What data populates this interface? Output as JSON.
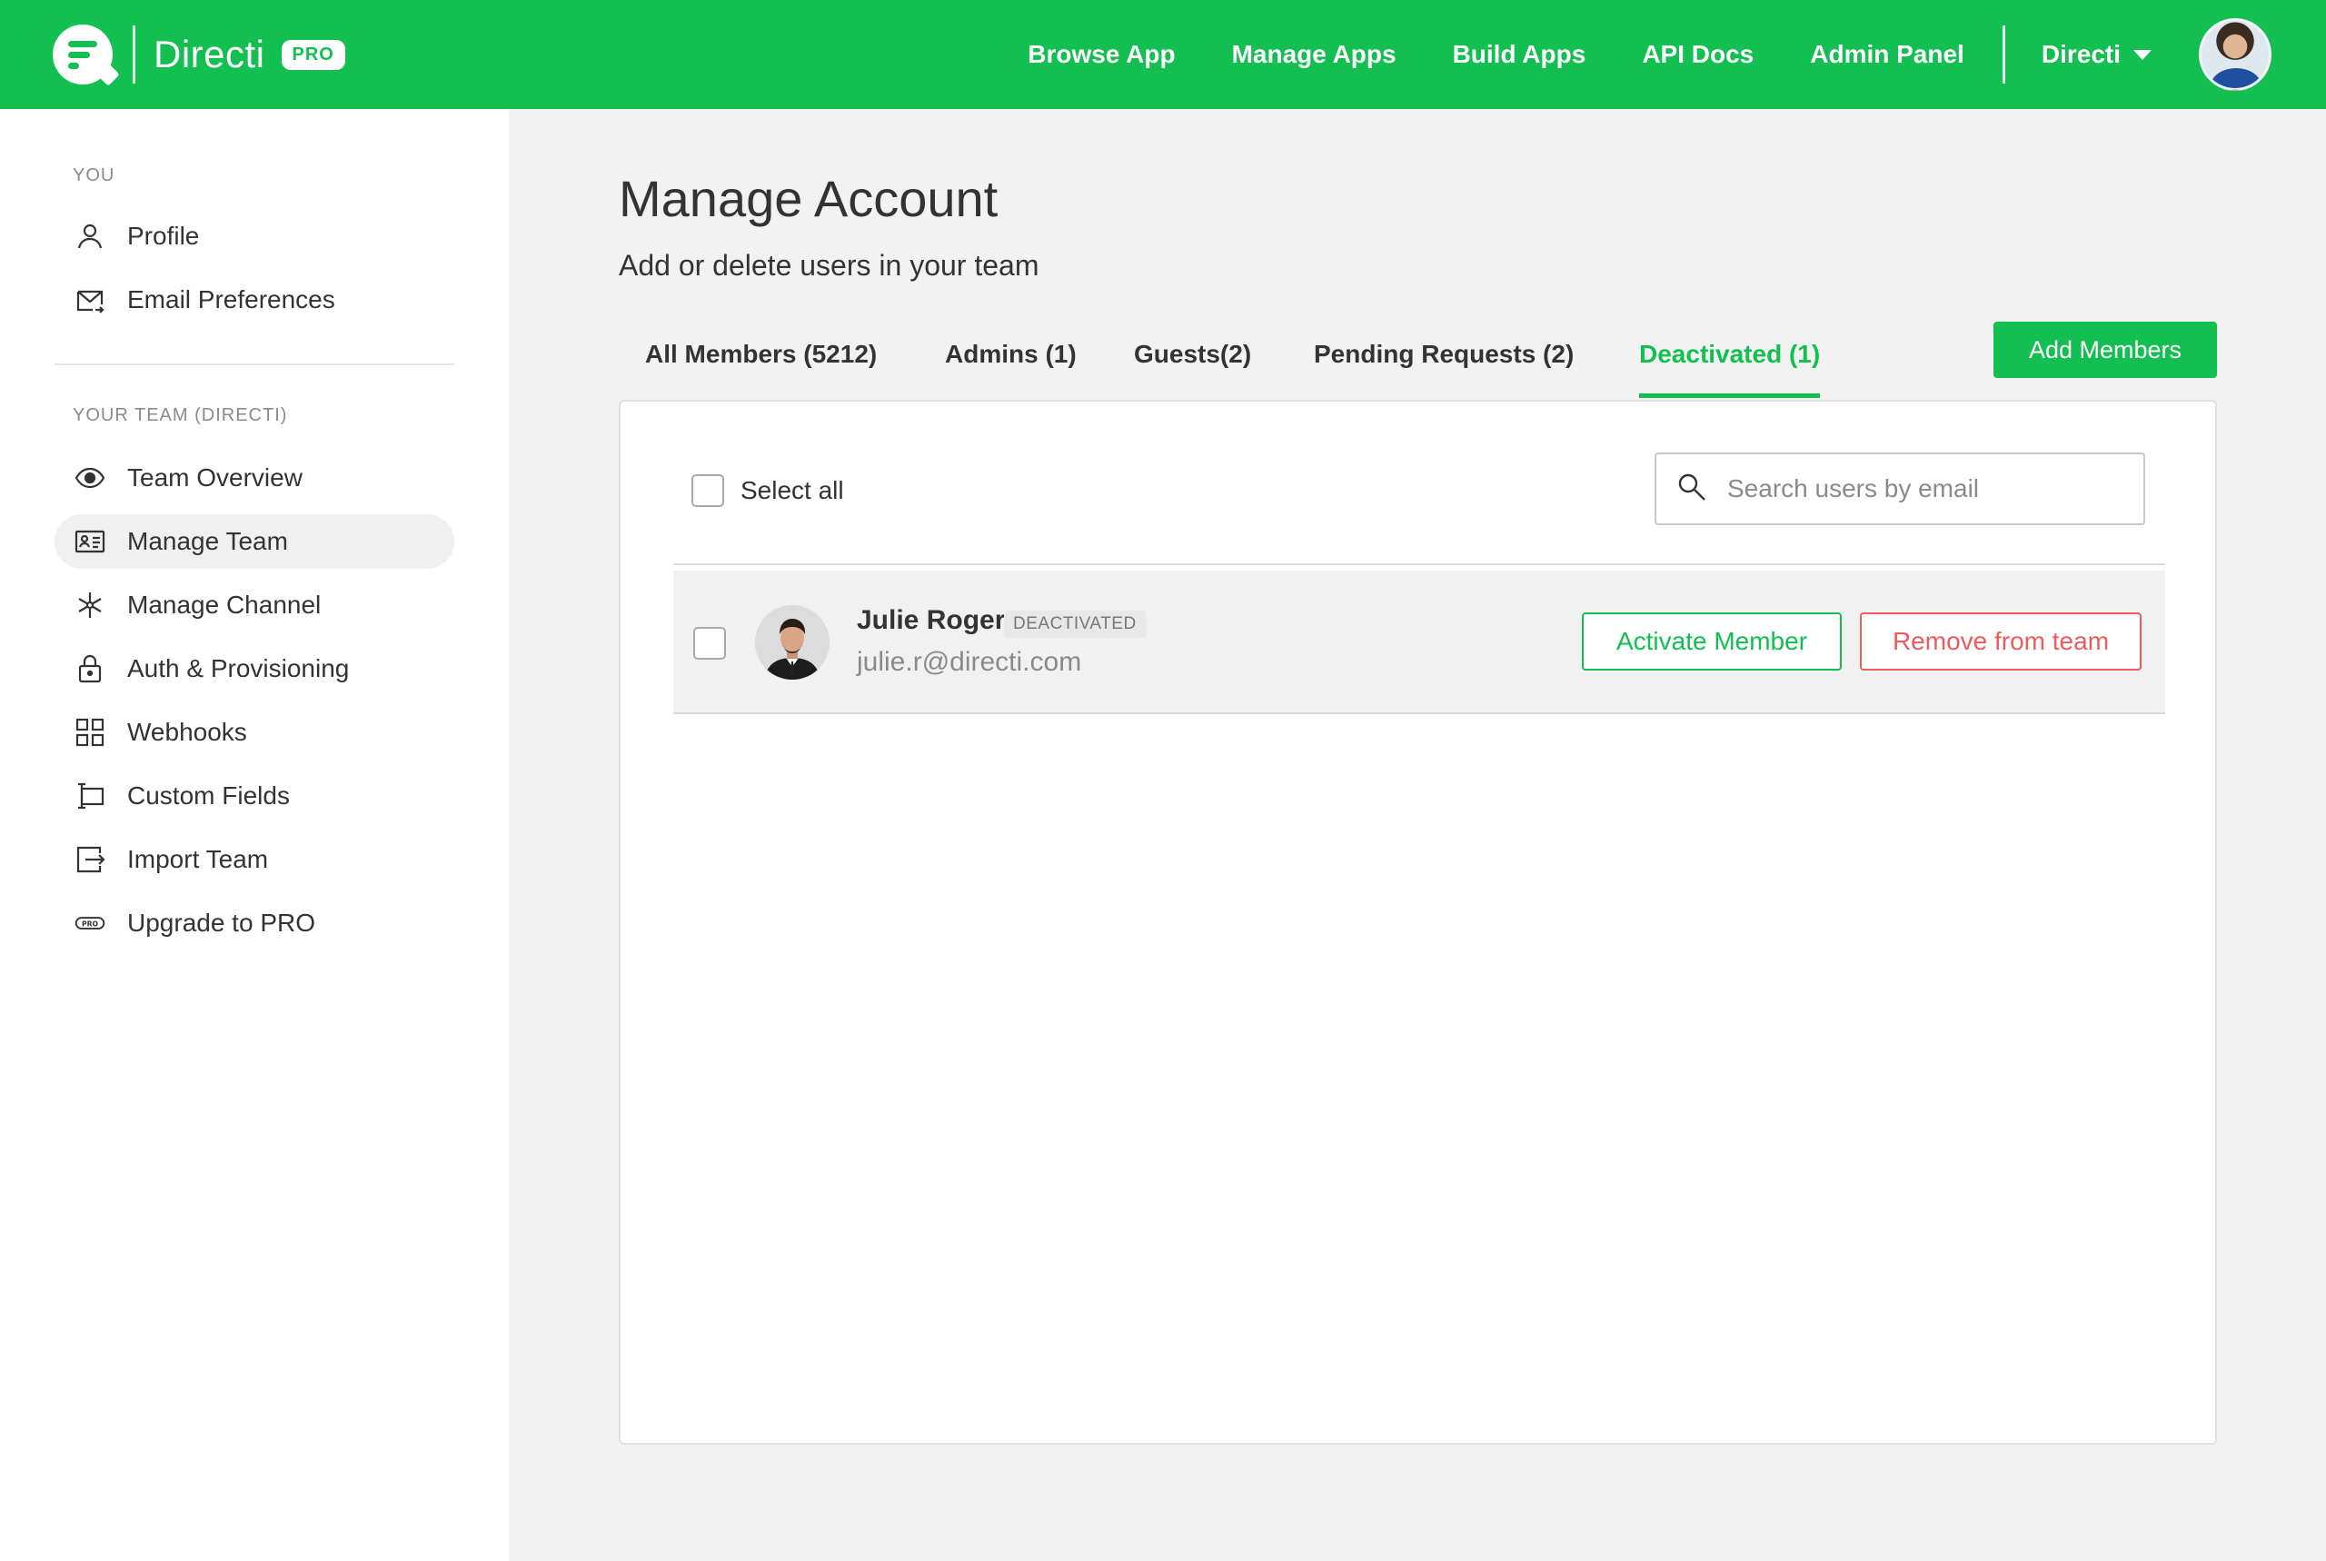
{
  "header": {
    "brand_name": "Directi",
    "plan_badge": "PRO",
    "nav": [
      {
        "label": "Browse App"
      },
      {
        "label": "Manage Apps"
      },
      {
        "label": "Build Apps"
      },
      {
        "label": "API Docs"
      },
      {
        "label": "Admin Panel"
      }
    ],
    "org_selector": "Directi",
    "accent_color": "#12bf50"
  },
  "sidebar": {
    "you_section": {
      "title": "YOU",
      "items": [
        {
          "label": "Profile",
          "icon": "user-icon"
        },
        {
          "label": "Email Preferences",
          "icon": "mail-icon"
        }
      ]
    },
    "team_section": {
      "title": "YOUR TEAM (DIRECTI)",
      "items": [
        {
          "label": "Team Overview",
          "icon": "eye-icon"
        },
        {
          "label": "Manage Team",
          "icon": "id-card-icon",
          "active": true
        },
        {
          "label": "Manage Channel",
          "icon": "asterisk-icon"
        },
        {
          "label": "Auth & Provisioning",
          "icon": "lock-icon"
        },
        {
          "label": "Webhooks",
          "icon": "grid-icon"
        },
        {
          "label": "Custom Fields",
          "icon": "fields-icon"
        },
        {
          "label": "Import Team",
          "icon": "import-icon"
        },
        {
          "label": "Upgrade to PRO",
          "icon": "pro-icon"
        }
      ]
    }
  },
  "main": {
    "title": "Manage Account",
    "subtitle": "Add or delete users in your team",
    "tabs": [
      {
        "label": "All Members (5212)"
      },
      {
        "label": "Admins (1)"
      },
      {
        "label": "Guests(2)"
      },
      {
        "label": "Pending Requests (2)"
      },
      {
        "label": "Deactivated (1)",
        "active": true
      }
    ],
    "add_members_label": "Add Members",
    "select_all_label": "Select all",
    "search": {
      "placeholder": "Search users by email",
      "value": ""
    },
    "members": [
      {
        "name": "Julie Roger",
        "status": "DEACTIVATED",
        "email": "julie.r@directi.com",
        "activate_label": "Activate Member",
        "remove_label": "Remove from team"
      }
    ]
  }
}
